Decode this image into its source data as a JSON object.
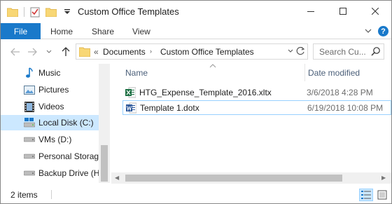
{
  "window": {
    "title": "Custom Office Templates"
  },
  "ribbon": {
    "file": "File",
    "home": "Home",
    "share": "Share",
    "view": "View",
    "help": "?"
  },
  "address": {
    "overflow": "«",
    "crumbs": [
      "Documents",
      "Custom Office Templates"
    ]
  },
  "search": {
    "placeholder": "Search Cu..."
  },
  "sidebar": {
    "items": [
      {
        "label": "Music",
        "icon": "music-icon"
      },
      {
        "label": "Pictures",
        "icon": "pictures-icon"
      },
      {
        "label": "Videos",
        "icon": "videos-icon"
      },
      {
        "label": "Local Disk (C:)",
        "icon": "local-disk-icon",
        "selected": true
      },
      {
        "label": "VMs (D:)",
        "icon": "drive-icon"
      },
      {
        "label": "Personal Storage",
        "icon": "drive-icon"
      },
      {
        "label": "Backup Drive (H",
        "icon": "drive-icon"
      }
    ]
  },
  "columns": {
    "name": "Name",
    "date": "Date modified"
  },
  "files": [
    {
      "name": "HTG_Expense_Template_2016.xltx",
      "date": "3/6/2018 4:28 PM",
      "icon": "excel-template-icon"
    },
    {
      "name": "Template 1.dotx",
      "date": "6/19/2018 10:08 PM",
      "icon": "word-template-icon",
      "selected": true
    }
  ],
  "status": {
    "count": "2 items"
  },
  "colors": {
    "accent": "#1979ca",
    "selection": "#cce8ff",
    "selection_border": "#99d1ff",
    "excel": "#1d7044",
    "word": "#2b579a",
    "folder": "#f8d775"
  }
}
